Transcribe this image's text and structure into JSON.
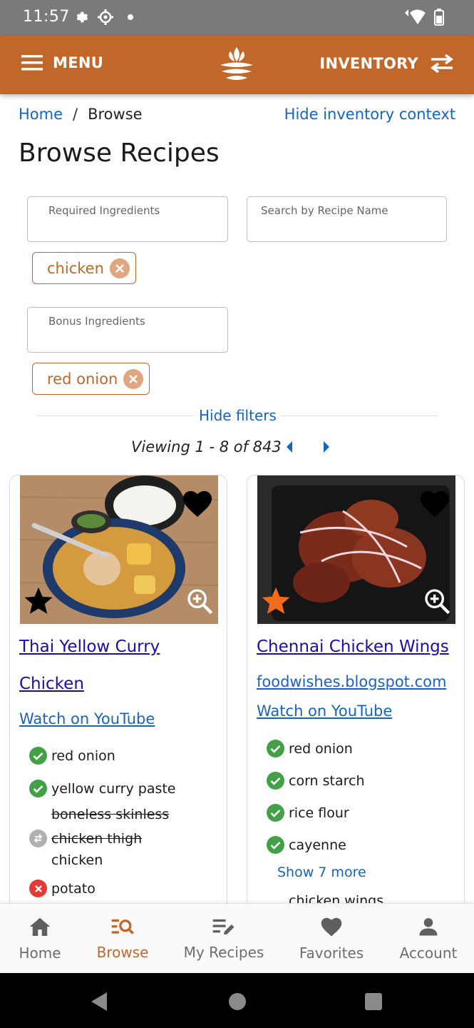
{
  "status_bar": {
    "time": "11:57",
    "icons_left": [
      "gear-icon",
      "settings-icon",
      "notification-dot-icon"
    ],
    "icons_right": [
      "wifi-icon",
      "battery-icon"
    ]
  },
  "app_bar": {
    "menu_label": "MENU",
    "inventory_label": "INVENTORY",
    "brand_color": "#c2672a"
  },
  "breadcrumb": {
    "home": "Home",
    "separator": "/",
    "current": "Browse"
  },
  "hide_inventory_context": "Hide inventory context",
  "page_title": "Browse Recipes",
  "filters": {
    "required_label": "Required Ingredients",
    "search_label": "Search by Recipe Name",
    "required_chips": [
      "chicken"
    ],
    "bonus_label": "Bonus Ingredients",
    "bonus_chips": [
      "red onion"
    ],
    "hide_filters": "Hide filters"
  },
  "pagination": {
    "viewing": "Viewing 1 - 8 of 843"
  },
  "recipes": [
    {
      "title_line1": "Thai Yellow Curry",
      "title_line2": "Chicken",
      "links": [
        "Watch on YouTube"
      ],
      "star_color": "#000000",
      "ingredients": [
        {
          "name": "red onion",
          "status": "have"
        },
        {
          "name": "yellow curry paste",
          "status": "have"
        },
        {
          "name": "boneless skinless",
          "status": "substitute-line"
        },
        {
          "name": "chicken thigh",
          "status": "substitute"
        },
        {
          "name": "chicken",
          "status": "substitute-for"
        },
        {
          "name": "potato",
          "status": "missing"
        }
      ]
    },
    {
      "title_line1": "Chennai Chicken Wings",
      "links": [
        "foodwishes.blogspot.com",
        "Watch on YouTube"
      ],
      "star_color": "#f26b1d",
      "ingredients": [
        {
          "name": "red onion",
          "status": "have"
        },
        {
          "name": "corn starch",
          "status": "have"
        },
        {
          "name": "rice flour",
          "status": "have"
        },
        {
          "name": "cayenne",
          "status": "have"
        }
      ],
      "show_more": "Show 7 more",
      "cut_off_item": "chicken wings"
    }
  ],
  "bottom_nav": [
    {
      "label": "Home",
      "icon": "home-icon",
      "active": false
    },
    {
      "label": "Browse",
      "icon": "browse-icon",
      "active": true
    },
    {
      "label": "My Recipes",
      "icon": "my-recipes-icon",
      "active": false
    },
    {
      "label": "Favorites",
      "icon": "heart-icon",
      "active": false
    },
    {
      "label": "Account",
      "icon": "account-icon",
      "active": false
    }
  ],
  "colors": {
    "accent": "#c2672a",
    "link": "#1565c0",
    "have": "#43a047",
    "missing": "#e53935",
    "substitute": "#b0b0b0"
  }
}
